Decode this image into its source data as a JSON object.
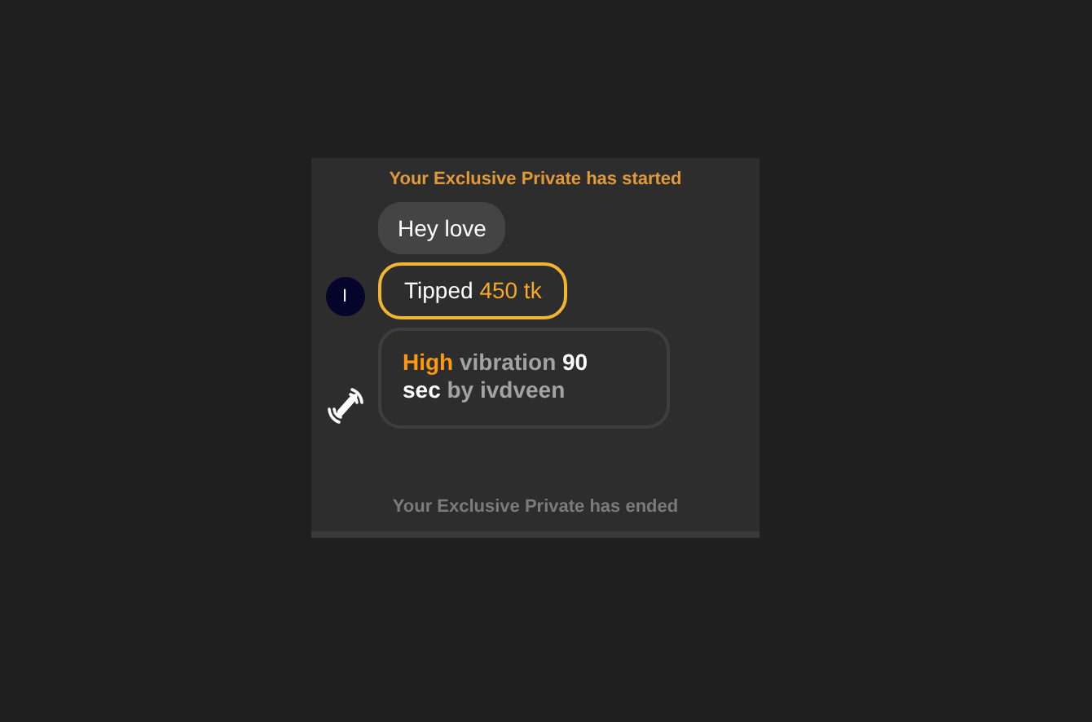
{
  "notices": [
    {
      "kind": "start",
      "text": "Your Exclusive Private has started"
    },
    {
      "kind": "end",
      "text": "Your Exclusive Private has ended"
    }
  ],
  "messages": [
    {
      "kind": "text",
      "segments": [
        {
          "color": "#ffffff",
          "text": "Hey love"
        }
      ]
    },
    {
      "kind": "tip",
      "avatar": "I",
      "segments": [
        {
          "color": "#ffffff",
          "text": "Tipped"
        },
        {
          "color": "#f6a828",
          "text": "450 tk"
        }
      ]
    },
    {
      "kind": "vibration",
      "segments": [
        {
          "color": "#ff9a10",
          "text": "High"
        },
        {
          "color": "#a3a3a3",
          "text": "vibration"
        },
        {
          "color": "#ffffff",
          "text": "90 sec"
        },
        {
          "color": "#a3a3a3",
          "text": "by ivdveen"
        }
      ]
    }
  ]
}
